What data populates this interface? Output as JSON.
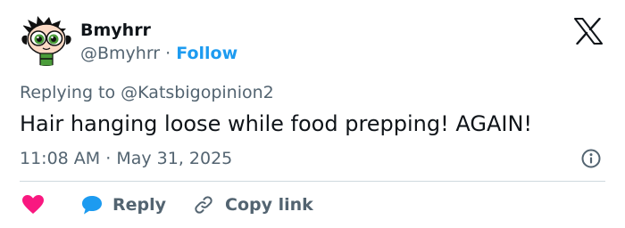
{
  "author": {
    "name": "Bmyhrr",
    "handle": "@Bmyhrr",
    "separator": "·",
    "follow_label": "Follow"
  },
  "reply_context": {
    "prefix": "Replying to",
    "mention": "@Katsbigopinion2"
  },
  "tweet": {
    "text": "Hair hanging loose while food prepping! AGAIN!",
    "time": "11:08 AM",
    "separator": "·",
    "date": "May 31, 2025"
  },
  "actions": {
    "like_icon": "heart-icon",
    "reply_label": "Reply",
    "copy_link_label": "Copy link"
  },
  "colors": {
    "text": "#0f1419",
    "secondary": "#536471",
    "accent": "#1d9bf0",
    "like": "#f91880",
    "divider": "#cfd9de"
  }
}
